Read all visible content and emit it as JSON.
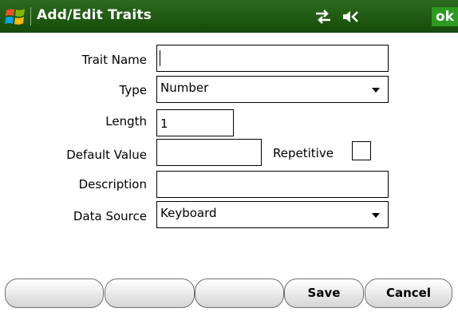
{
  "titlebar": {
    "title": "Add/Edit Traits",
    "ok_label": "ok",
    "icons": [
      "windows-start-icon",
      "connectivity-icon",
      "volume-icon"
    ]
  },
  "form": {
    "trait_name": {
      "label": "Trait Name",
      "value": ""
    },
    "type": {
      "label": "Type",
      "value": "Number"
    },
    "length": {
      "label": "Length",
      "value": "1"
    },
    "default_value": {
      "label": "Default Value",
      "value": ""
    },
    "repetitive": {
      "label": "Repetitive",
      "checked": false
    },
    "description": {
      "label": "Description",
      "value": ""
    },
    "data_source": {
      "label": "Data Source",
      "value": "Keyboard"
    }
  },
  "softkeys": {
    "key1": "",
    "key2": "",
    "key3": "",
    "save": "Save",
    "cancel": "Cancel"
  },
  "colors": {
    "titlebar_green": "#1f5a12",
    "ok_green": "#2e9a1f"
  }
}
